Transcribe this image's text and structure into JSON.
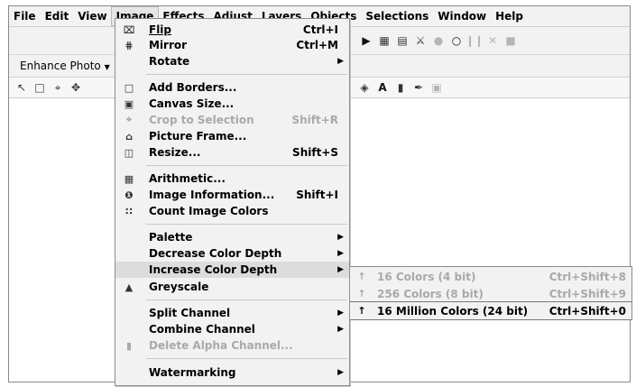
{
  "menubar": {
    "items": [
      "File",
      "Edit",
      "View",
      "Image",
      "Effects",
      "Adjust",
      "Layers",
      "Objects",
      "Selections",
      "Window",
      "Help"
    ],
    "active": "Image"
  },
  "toolbar": {
    "enhance_photo_label": "Enhance Photo"
  },
  "image_menu": {
    "items": [
      {
        "icon": "flip-icon",
        "label": "Flip",
        "shortcut": "Ctrl+I",
        "enabled": true,
        "submenu": false
      },
      {
        "icon": "mirror-icon",
        "label": "Mirror",
        "shortcut": "Ctrl+M",
        "enabled": true,
        "submenu": false
      },
      {
        "icon": "",
        "label": "Rotate",
        "shortcut": "",
        "enabled": true,
        "submenu": true
      },
      {
        "icon": "add-borders-icon",
        "label": "Add Borders...",
        "shortcut": "",
        "enabled": true,
        "submenu": false
      },
      {
        "icon": "canvas-size-icon",
        "label": "Canvas Size...",
        "shortcut": "",
        "enabled": true,
        "submenu": false
      },
      {
        "icon": "crop-icon",
        "label": "Crop to Selection",
        "shortcut": "Shift+R",
        "enabled": false,
        "submenu": false
      },
      {
        "icon": "picture-frame-icon",
        "label": "Picture Frame...",
        "shortcut": "",
        "enabled": true,
        "submenu": false
      },
      {
        "icon": "resize-icon",
        "label": "Resize...",
        "shortcut": "Shift+S",
        "enabled": true,
        "submenu": false
      },
      {
        "icon": "arithmetic-icon",
        "label": "Arithmetic...",
        "shortcut": "",
        "enabled": true,
        "submenu": false
      },
      {
        "icon": "info-icon",
        "label": "Image Information...",
        "shortcut": "Shift+I",
        "enabled": true,
        "submenu": false
      },
      {
        "icon": "count-colors-icon",
        "label": "Count Image Colors",
        "shortcut": "",
        "enabled": true,
        "submenu": false
      },
      {
        "icon": "",
        "label": "Palette",
        "shortcut": "",
        "enabled": true,
        "submenu": true
      },
      {
        "icon": "",
        "label": "Decrease Color Depth",
        "shortcut": "",
        "enabled": true,
        "submenu": true
      },
      {
        "icon": "",
        "label": "Increase Color Depth",
        "shortcut": "",
        "enabled": true,
        "submenu": true,
        "highlighted": true
      },
      {
        "icon": "greyscale-icon",
        "label": "Greyscale",
        "shortcut": "",
        "enabled": true,
        "submenu": false
      },
      {
        "icon": "",
        "label": "Split Channel",
        "shortcut": "",
        "enabled": true,
        "submenu": true
      },
      {
        "icon": "",
        "label": "Combine Channel",
        "shortcut": "",
        "enabled": true,
        "submenu": true
      },
      {
        "icon": "alpha-channel-icon",
        "label": "Delete Alpha Channel...",
        "shortcut": "",
        "enabled": false,
        "submenu": false
      },
      {
        "icon": "",
        "label": "Watermarking",
        "shortcut": "",
        "enabled": true,
        "submenu": true
      }
    ]
  },
  "increase_depth_submenu": {
    "items": [
      {
        "label": "16 Colors (4 bit)",
        "shortcut": "Ctrl+Shift+8",
        "enabled": false
      },
      {
        "label": "256 Colors (8 bit)",
        "shortcut": "Ctrl+Shift+9",
        "enabled": false
      },
      {
        "label": "16 Million Colors (24 bit)",
        "shortcut": "Ctrl+Shift+0",
        "enabled": true,
        "selected": true
      }
    ]
  }
}
